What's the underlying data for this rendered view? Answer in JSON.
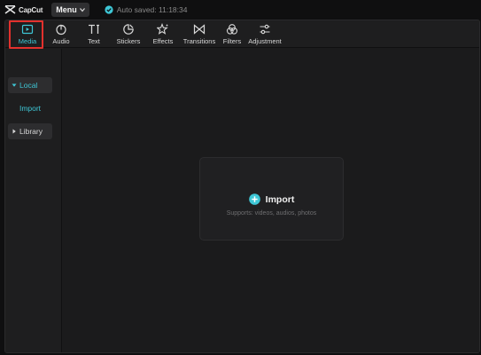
{
  "titlebar": {
    "brand": "CapCut",
    "menu_label": "Menu",
    "autosave_text": "Auto saved: 11:18:34"
  },
  "toolbar": {
    "items": [
      {
        "label": "Media",
        "icon": "media-play-icon"
      },
      {
        "label": "Audio",
        "icon": "audio-icon"
      },
      {
        "label": "Text",
        "icon": "text-icon"
      },
      {
        "label": "Stickers",
        "icon": "sticker-icon"
      },
      {
        "label": "Effects",
        "icon": "effects-star-icon"
      },
      {
        "label": "Transitions",
        "icon": "transition-bowtie-icon"
      },
      {
        "label": "Filters",
        "icon": "filters-circles-icon"
      },
      {
        "label": "Adjustment",
        "icon": "adjustment-sliders-icon"
      }
    ],
    "active": "Media"
  },
  "sidebar": {
    "local": "Local",
    "import": "Import",
    "library": "Library"
  },
  "main": {
    "import_label": "Import",
    "supports_text": "Supports: videos, audios, photos"
  },
  "colors": {
    "accent": "#3ec7d6",
    "highlight": "#e3312d",
    "panel": "#1b1b1c"
  }
}
